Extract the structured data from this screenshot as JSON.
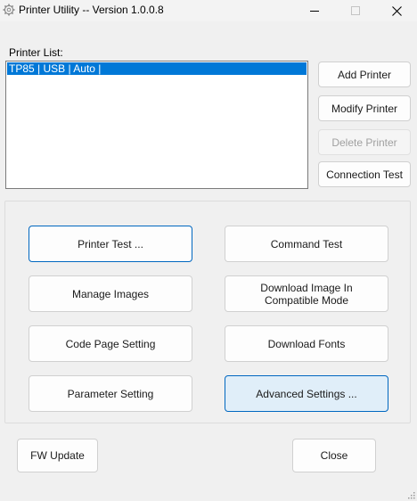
{
  "window": {
    "title": "Printer Utility -- Version 1.0.0.8",
    "icon": "gear-icon"
  },
  "printer_list": {
    "label": "Printer List:",
    "items": [
      {
        "label": "TP85 | USB | Auto |",
        "selected": true
      }
    ]
  },
  "side_buttons": {
    "add": "Add Printer",
    "modify": "Modify Printer",
    "delete": "Delete Printer",
    "connection_test": "Connection Test"
  },
  "actions": {
    "printer_test": "Printer Test ...",
    "command_test": "Command Test",
    "manage_images": "Manage Images",
    "download_image": "Download Image In Compatible Mode",
    "code_page": "Code Page Setting",
    "download_fonts": "Download Fonts",
    "parameter": "Parameter Setting",
    "advanced": "Advanced Settings ..."
  },
  "footer": {
    "fw_update": "FW Update",
    "close": "Close"
  },
  "colors": {
    "selection": "#0078d7",
    "focus_border": "#0067c0",
    "hover_fill": "#e0eef9"
  }
}
